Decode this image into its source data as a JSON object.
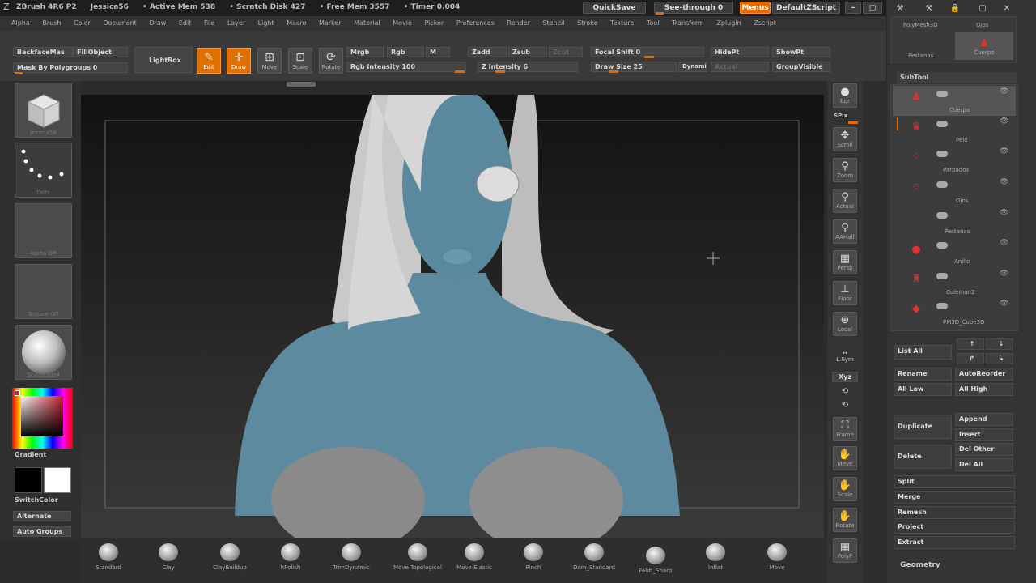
{
  "titlebar": {
    "items": [
      "ZBrush 4R6 P2",
      "Jessica56",
      "• Active Mem 538",
      "• Scratch Disk 427",
      "• Free Mem 3557",
      "• Timer 0.004"
    ],
    "quicksave": "QuickSave",
    "see_through": "See-through  0",
    "menus": "Menus",
    "default_zscript": "DefaultZScript"
  },
  "menubar": [
    "Alpha",
    "Brush",
    "Color",
    "Document",
    "Draw",
    "Edit",
    "File",
    "Layer",
    "Light",
    "Macro",
    "Marker",
    "Material",
    "Movie",
    "Picker",
    "Preferences",
    "Render",
    "Stencil",
    "Stroke",
    "Texture",
    "Tool",
    "Transform",
    "Zplugin",
    "Zscript"
  ],
  "toolbar": {
    "backface": "BackfaceMas",
    "fill_object": "FillObject",
    "mask_polygroups": "Mask By Polygroups 0",
    "lightbox": "LightBox",
    "edit": "Edit",
    "draw": "Draw",
    "move": "Move",
    "scale": "Scale",
    "rotate": "Rotate",
    "mrgb": "Mrgb",
    "rgb": "Rgb",
    "m": "M",
    "rgb_intensity": "Rgb  Intensity 100",
    "zadd": "Zadd",
    "zsub": "Zsub",
    "zcut": "Zcut",
    "z_intensity": "Z Intensity 6",
    "focal_shift": "Focal Shift 0",
    "draw_size": "Draw Size 25",
    "dynamic": "Dynamic",
    "hidept": "HidePt",
    "showpt": "ShowPt",
    "groupvisible": "GroupVisible",
    "actual": "Actual"
  },
  "left": {
    "tool_caption": "Jessica56",
    "stroke_caption": "Dots",
    "alpha_caption": "Alpha Off",
    "texture_caption": "Texture Off",
    "material_caption": "SkinShade4",
    "gradient": "Gradient",
    "switchcolor": "SwitchColor",
    "alternate": "Alternate",
    "auto_groups": "Auto Groups"
  },
  "right_shelf": {
    "bpr": "Bpr",
    "spix": "SPix",
    "scroll": "Scroll",
    "zoom": "Zoom",
    "actual": "Actual",
    "aahalf": "AAHalf",
    "persp": "Persp",
    "floor": "Floor",
    "local": "Local",
    "lsym": "L.Sym",
    "xyz": "Xyz",
    "frame": "Frame",
    "move": "Move",
    "scale": "Scale",
    "rotate": "Rotate",
    "polyf": "PolyF"
  },
  "brushes": [
    "Standard",
    "Clay",
    "ClayBuildup",
    "hPolish",
    "TrimDynamic",
    "Move Topological",
    "Move Elastic",
    "Pinch",
    "Dam_Standard",
    "Fabff_Sharp",
    "Inflat",
    "Move"
  ],
  "panel": {
    "polymesh": "PolyMesh3D",
    "ojos": "Ojos",
    "pestanas": "Pestanas",
    "cuerpo_thumb": "Cuerpo",
    "subtool": "SubTool",
    "subtools": [
      "Cuerpo",
      "Pelo",
      "Parpados",
      "Ojos",
      "Pestanas",
      "Anillo",
      "Coleman2",
      "PM3D_Cube3D"
    ],
    "list_all": "List All",
    "rename": "Rename",
    "autoreorder": "AutoReorder",
    "all_low": "All Low",
    "all_high": "All High",
    "duplicate": "Duplicate",
    "append": "Append",
    "insert": "Insert",
    "delete": "Delete",
    "del_other": "Del Other",
    "del_all": "Del All",
    "split": "Split",
    "merge": "Merge",
    "remesh": "Remesh",
    "project": "Project",
    "extract": "Extract",
    "geometry": "Geometry"
  },
  "colors": {
    "accent": "#e66a00",
    "skin": "#5e8aa0",
    "hair": "#c9c9c9"
  }
}
